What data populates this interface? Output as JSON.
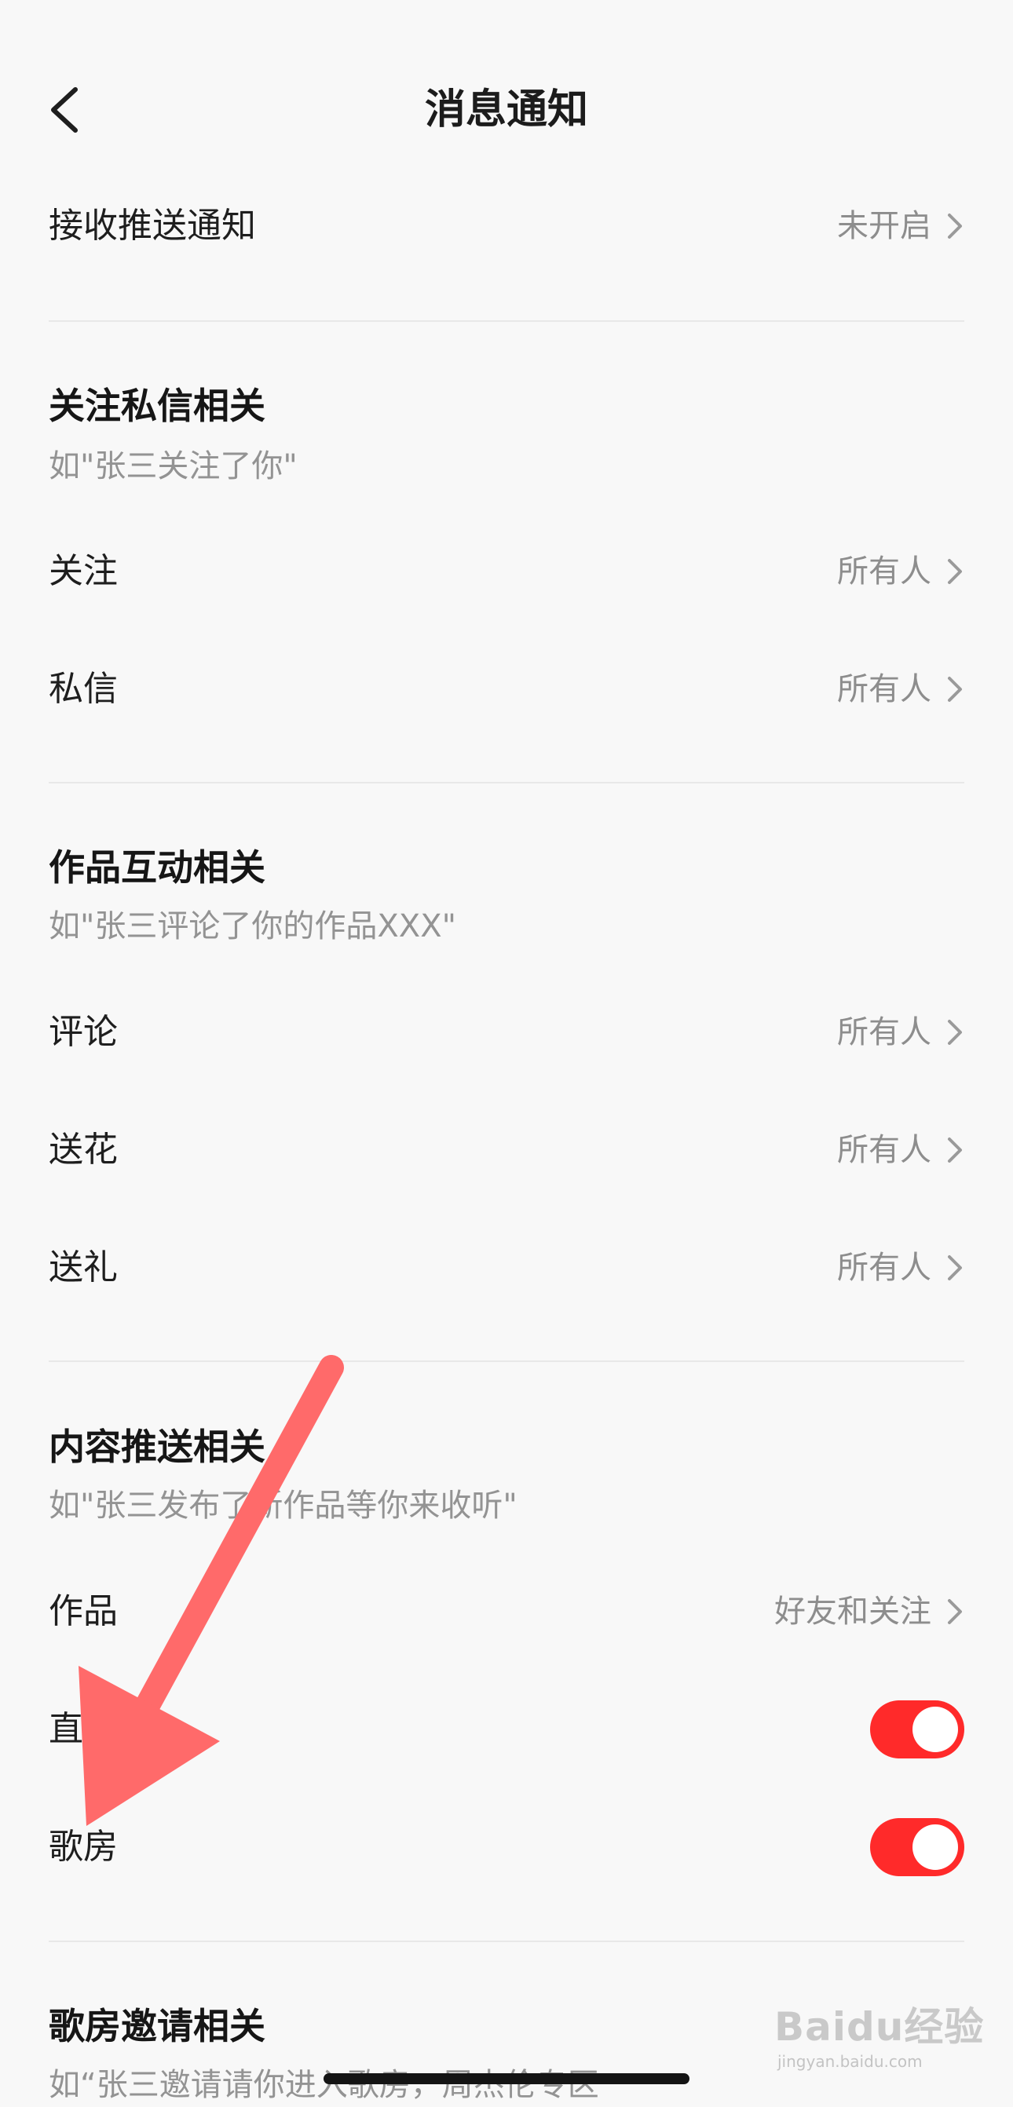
{
  "header": {
    "title": "消息通知",
    "back_icon": "chevron-left-icon"
  },
  "push_row": {
    "label": "接收推送通知",
    "value": "未开启"
  },
  "sections": [
    {
      "title": "关注私信相关",
      "desc": "如\"张三关注了你\"",
      "rows": [
        {
          "label": "关注",
          "value": "所有人"
        },
        {
          "label": "私信",
          "value": "所有人"
        }
      ]
    },
    {
      "title": "作品互动相关",
      "desc": "如\"张三评论了你的作品XXX\"",
      "rows": [
        {
          "label": "评论",
          "value": "所有人"
        },
        {
          "label": "送花",
          "value": "所有人"
        },
        {
          "label": "送礼",
          "value": "所有人"
        }
      ]
    },
    {
      "title": "内容推送相关",
      "desc": "如\"张三发布了新作品等你来收听\"",
      "rows": [
        {
          "label": "作品",
          "value": "好友和关注"
        },
        {
          "label": "直播",
          "toggle": true
        },
        {
          "label": "歌房",
          "toggle": true
        }
      ]
    },
    {
      "title": "歌房邀请相关",
      "desc": "如“张三邀请请你进入歌房，周杰伦专区"
    }
  ],
  "colors": {
    "toggle_on": "#ff2a2a",
    "arrow": "#ff6a6a"
  },
  "watermark": {
    "brand": "Baidu经验",
    "url": "jingyan.baidu.com"
  }
}
